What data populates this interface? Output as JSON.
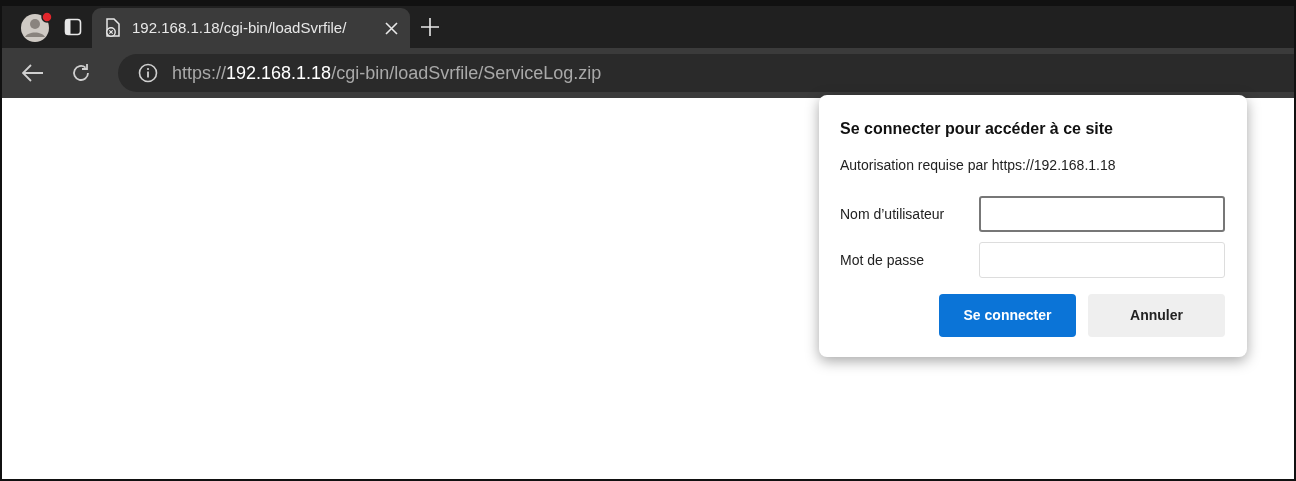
{
  "tab": {
    "title": "192.168.1.18/cgi-bin/loadSvrfile/",
    "selected": true
  },
  "address_bar": {
    "url_parts": [
      {
        "text": "https://",
        "emphasis": false
      },
      {
        "text": "192.168.1.18",
        "emphasis": true
      },
      {
        "text": "/cgi-bin/loadSvrfile/ServiceLog.zip",
        "emphasis": false
      }
    ]
  },
  "dialog": {
    "title": "Se connecter pour accéder à ce site",
    "subtitle": "Autorisation requise par https://192.168.1.18",
    "fields": [
      {
        "label": "Nom d’utilisateur",
        "focused": true
      },
      {
        "label": "Mot de passe",
        "focused": false
      }
    ],
    "buttons": [
      {
        "label": "Se connecter",
        "kind": "primary"
      },
      {
        "label": "Annuler",
        "kind": "secondary"
      }
    ]
  }
}
